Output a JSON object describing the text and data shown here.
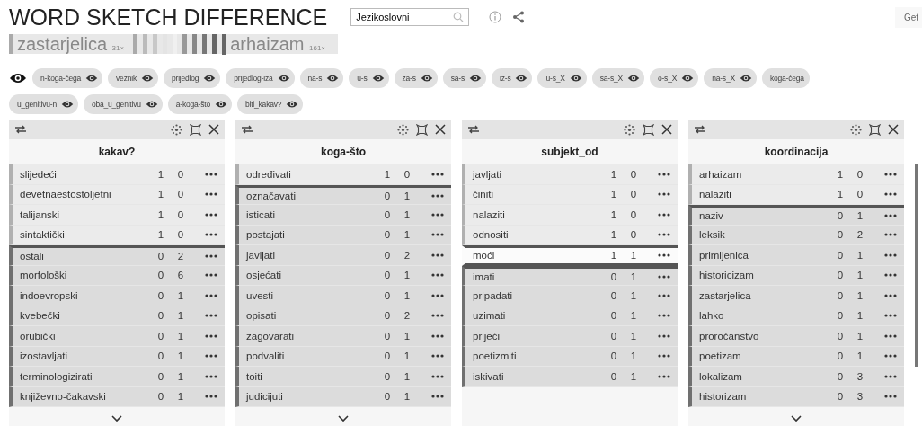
{
  "title": "WORD SKETCH DIFFERENCE",
  "search": {
    "value": "Jezikoslovni"
  },
  "get_button": "Get",
  "legend": {
    "first": {
      "word": "zastarjelica",
      "count": "31×"
    },
    "second": {
      "word": "arhaizam",
      "count": "161×"
    }
  },
  "chip_rows": [
    [
      {
        "label": "n-koga-čega",
        "visible": true
      },
      {
        "label": "veznik",
        "visible": true
      },
      {
        "label": "prijedlog",
        "visible": true
      },
      {
        "label": "prijedlog-iza",
        "visible": true
      },
      {
        "label": "na-s",
        "visible": true
      },
      {
        "label": "u-s",
        "visible": true
      },
      {
        "label": "za-s",
        "visible": true
      },
      {
        "label": "sa-s",
        "visible": true
      },
      {
        "label": "iz-s",
        "visible": true
      },
      {
        "label": "u-s_X",
        "visible": true
      },
      {
        "label": "sa-s_X",
        "visible": true
      },
      {
        "label": "o-s_X",
        "visible": true
      },
      {
        "label": "na-s_X",
        "visible": true
      },
      {
        "label": "koga-čega"
      }
    ],
    [
      {
        "label": "u_genitivu-n",
        "visible": true
      },
      {
        "label": "oba_u_genitivu",
        "visible": true
      },
      {
        "label": "a-koga-što",
        "visible": true
      },
      {
        "label": "biti_kakav?",
        "visible": true
      }
    ]
  ],
  "panels": [
    {
      "title": "kakav?",
      "has_more": true,
      "rows": [
        {
          "word": "slijedeći",
          "a": "1",
          "b": "0",
          "kind": "first"
        },
        {
          "word": "devetnaestostoljetni",
          "a": "1",
          "b": "0",
          "kind": "first"
        },
        {
          "word": "talijanski",
          "a": "1",
          "b": "0",
          "kind": "first"
        },
        {
          "word": "sintaktički",
          "a": "1",
          "b": "0",
          "kind": "first"
        },
        {
          "word": "ostali",
          "a": "0",
          "b": "2",
          "kind": "second"
        },
        {
          "word": "morfološki",
          "a": "0",
          "b": "6",
          "kind": "second"
        },
        {
          "word": "indoevropski",
          "a": "0",
          "b": "1",
          "kind": "second"
        },
        {
          "word": "kvebečki",
          "a": "0",
          "b": "1",
          "kind": "second"
        },
        {
          "word": "orubički",
          "a": "0",
          "b": "1",
          "kind": "second"
        },
        {
          "word": "izostavljati",
          "a": "0",
          "b": "1",
          "kind": "second"
        },
        {
          "word": "terminologizirati",
          "a": "0",
          "b": "1",
          "kind": "second"
        },
        {
          "word": "književno-čakavski",
          "a": "0",
          "b": "1",
          "kind": "second"
        }
      ]
    },
    {
      "title": "koga-što",
      "has_more": true,
      "rows": [
        {
          "word": "određivati",
          "a": "1",
          "b": "0",
          "kind": "first"
        },
        {
          "word": "označavati",
          "a": "0",
          "b": "1",
          "kind": "second"
        },
        {
          "word": "isticati",
          "a": "0",
          "b": "1",
          "kind": "second"
        },
        {
          "word": "postajati",
          "a": "0",
          "b": "1",
          "kind": "second"
        },
        {
          "word": "javljati",
          "a": "0",
          "b": "2",
          "kind": "second"
        },
        {
          "word": "osjećati",
          "a": "0",
          "b": "1",
          "kind": "second"
        },
        {
          "word": "uvesti",
          "a": "0",
          "b": "1",
          "kind": "second"
        },
        {
          "word": "opisati",
          "a": "0",
          "b": "2",
          "kind": "second"
        },
        {
          "word": "zagovarati",
          "a": "0",
          "b": "1",
          "kind": "second"
        },
        {
          "word": "podvaliti",
          "a": "0",
          "b": "1",
          "kind": "second"
        },
        {
          "word": "toiti",
          "a": "0",
          "b": "1",
          "kind": "second"
        },
        {
          "word": "judicijuti",
          "a": "0",
          "b": "1",
          "kind": "second"
        }
      ]
    },
    {
      "title": "subjekt_od",
      "has_more": false,
      "rows": [
        {
          "word": "javljati",
          "a": "1",
          "b": "0",
          "kind": "first"
        },
        {
          "word": "činiti",
          "a": "1",
          "b": "0",
          "kind": "first"
        },
        {
          "word": "nalaziti",
          "a": "1",
          "b": "0",
          "kind": "first"
        },
        {
          "word": "odnositi",
          "a": "1",
          "b": "0",
          "kind": "first"
        },
        {
          "word": "moći",
          "a": "1",
          "b": "1",
          "kind": "both"
        },
        {
          "word": "imati",
          "a": "0",
          "b": "1",
          "kind": "second"
        },
        {
          "word": "pripadati",
          "a": "0",
          "b": "1",
          "kind": "second"
        },
        {
          "word": "uzimati",
          "a": "0",
          "b": "1",
          "kind": "second"
        },
        {
          "word": "prijeći",
          "a": "0",
          "b": "1",
          "kind": "second"
        },
        {
          "word": "poetizmiti",
          "a": "0",
          "b": "1",
          "kind": "second"
        },
        {
          "word": "iskivati",
          "a": "0",
          "b": "1",
          "kind": "second"
        }
      ]
    },
    {
      "title": "koordinacija",
      "has_more": true,
      "rows": [
        {
          "word": "arhaizam",
          "a": "1",
          "b": "0",
          "kind": "first"
        },
        {
          "word": "nalaziti",
          "a": "1",
          "b": "0",
          "kind": "first"
        },
        {
          "word": "naziv",
          "a": "0",
          "b": "1",
          "kind": "second"
        },
        {
          "word": "leksik",
          "a": "0",
          "b": "2",
          "kind": "second"
        },
        {
          "word": "primljenica",
          "a": "0",
          "b": "1",
          "kind": "second"
        },
        {
          "word": "historicizam",
          "a": "0",
          "b": "1",
          "kind": "second"
        },
        {
          "word": "zastarjelica",
          "a": "0",
          "b": "1",
          "kind": "second"
        },
        {
          "word": "lahko",
          "a": "0",
          "b": "1",
          "kind": "second"
        },
        {
          "word": "proročanstvo",
          "a": "0",
          "b": "1",
          "kind": "second"
        },
        {
          "word": "poetizam",
          "a": "0",
          "b": "1",
          "kind": "second"
        },
        {
          "word": "lokalizam",
          "a": "0",
          "b": "3",
          "kind": "second"
        },
        {
          "word": "historizam",
          "a": "0",
          "b": "3",
          "kind": "second"
        }
      ]
    }
  ]
}
